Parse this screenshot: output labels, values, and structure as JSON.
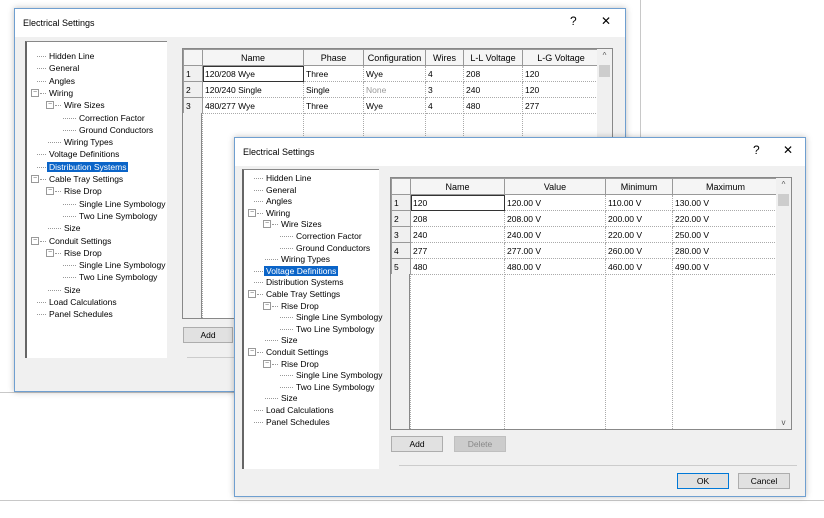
{
  "back_dialog": {
    "title": "Electrical Settings",
    "help_label": "?",
    "close_label": "✕",
    "tree": [
      {
        "label": "Hidden Line",
        "level": 0
      },
      {
        "label": "General",
        "level": 0
      },
      {
        "label": "Angles",
        "level": 0
      },
      {
        "label": "Wiring",
        "level": 0,
        "expander": "⊟"
      },
      {
        "label": "Wire Sizes",
        "level": 1,
        "expander": "⊟"
      },
      {
        "label": "Correction Factor",
        "level": 2
      },
      {
        "label": "Ground Conductors",
        "level": 2
      },
      {
        "label": "Wiring Types",
        "level": 1
      },
      {
        "label": "Voltage Definitions",
        "level": 0
      },
      {
        "label": "Distribution Systems",
        "level": 0,
        "selected": true
      },
      {
        "label": "Cable Tray Settings",
        "level": 0,
        "expander": "⊟"
      },
      {
        "label": "Rise Drop",
        "level": 1,
        "expander": "⊟"
      },
      {
        "label": "Single Line Symbology",
        "level": 2
      },
      {
        "label": "Two Line Symbology",
        "level": 2
      },
      {
        "label": "Size",
        "level": 1
      },
      {
        "label": "Conduit Settings",
        "level": 0,
        "expander": "⊟"
      },
      {
        "label": "Rise Drop",
        "level": 1,
        "expander": "⊟"
      },
      {
        "label": "Single Line Symbology",
        "level": 2
      },
      {
        "label": "Two Line Symbology",
        "level": 2
      },
      {
        "label": "Size",
        "level": 1
      },
      {
        "label": "Load Calculations",
        "level": 0
      },
      {
        "label": "Panel Schedules",
        "level": 0
      }
    ],
    "grid": {
      "columns": [
        "Name",
        "Phase",
        "Configuration",
        "Wires",
        "L-L Voltage",
        "L-G Voltage"
      ],
      "rows": [
        {
          "num": "1",
          "cells": [
            "120/208 Wye",
            "Three",
            "Wye",
            "4",
            "208",
            "120"
          ]
        },
        {
          "num": "2",
          "cells": [
            "120/240 Single",
            "Single",
            "None",
            "3",
            "240",
            "120"
          ]
        },
        {
          "num": "3",
          "cells": [
            "480/277 Wye",
            "Three",
            "Wye",
            "4",
            "480",
            "277"
          ]
        }
      ]
    },
    "add_label": "Add"
  },
  "front_dialog": {
    "title": "Electrical Settings",
    "help_label": "?",
    "close_label": "✕",
    "tree": [
      {
        "label": "Hidden Line",
        "level": 0
      },
      {
        "label": "General",
        "level": 0
      },
      {
        "label": "Angles",
        "level": 0
      },
      {
        "label": "Wiring",
        "level": 0,
        "expander": "⊟"
      },
      {
        "label": "Wire Sizes",
        "level": 1,
        "expander": "⊟"
      },
      {
        "label": "Correction Factor",
        "level": 2
      },
      {
        "label": "Ground Conductors",
        "level": 2
      },
      {
        "label": "Wiring Types",
        "level": 1
      },
      {
        "label": "Voltage Definitions",
        "level": 0,
        "selected": true
      },
      {
        "label": "Distribution Systems",
        "level": 0
      },
      {
        "label": "Cable Tray Settings",
        "level": 0,
        "expander": "⊟"
      },
      {
        "label": "Rise Drop",
        "level": 1,
        "expander": "⊟"
      },
      {
        "label": "Single Line Symbology",
        "level": 2
      },
      {
        "label": "Two Line Symbology",
        "level": 2
      },
      {
        "label": "Size",
        "level": 1
      },
      {
        "label": "Conduit Settings",
        "level": 0,
        "expander": "⊟"
      },
      {
        "label": "Rise Drop",
        "level": 1,
        "expander": "⊟"
      },
      {
        "label": "Single Line Symbology",
        "level": 2
      },
      {
        "label": "Two Line Symbology",
        "level": 2
      },
      {
        "label": "Size",
        "level": 1
      },
      {
        "label": "Load Calculations",
        "level": 0
      },
      {
        "label": "Panel Schedules",
        "level": 0
      }
    ],
    "grid": {
      "columns": [
        "Name",
        "Value",
        "Minimum",
        "Maximum"
      ],
      "rows": [
        {
          "num": "1",
          "cells": [
            "120",
            "120.00 V",
            "110.00 V",
            "130.00 V"
          ]
        },
        {
          "num": "2",
          "cells": [
            "208",
            "208.00 V",
            "200.00 V",
            "220.00 V"
          ]
        },
        {
          "num": "3",
          "cells": [
            "240",
            "240.00 V",
            "220.00 V",
            "250.00 V"
          ]
        },
        {
          "num": "4",
          "cells": [
            "277",
            "277.00 V",
            "260.00 V",
            "280.00 V"
          ]
        },
        {
          "num": "5",
          "cells": [
            "480",
            "480.00 V",
            "460.00 V",
            "490.00 V"
          ]
        }
      ]
    },
    "add_label": "Add",
    "delete_label": "Delete",
    "ok_label": "OK",
    "cancel_label": "Cancel"
  },
  "colors": {
    "selection": "#0a64c8",
    "dialog_border": "#6f9fd0"
  }
}
